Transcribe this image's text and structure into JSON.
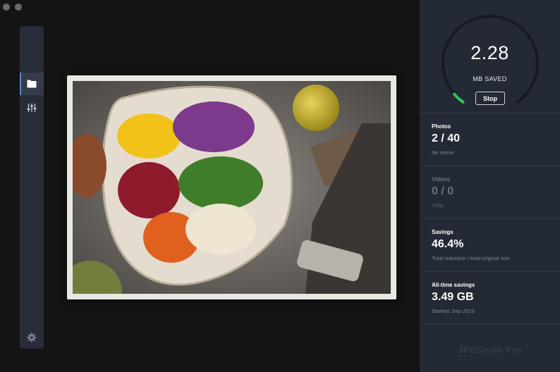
{
  "gauge": {
    "value": "2.28",
    "label": "MB SAVED",
    "stop_label": "Stop",
    "progress": 0.05,
    "progress_color": "#2fc95b"
  },
  "stats": [
    {
      "title": "Photos",
      "value": "2 / 40",
      "sub": "No resize",
      "dim": false
    },
    {
      "title": "Videos",
      "value": "0 / 0",
      "sub": "720p",
      "dim": true
    },
    {
      "title": "Savings",
      "value": "46.4%",
      "sub": "Total reduction / total original size",
      "dim": false
    },
    {
      "title": "All-time savings",
      "value": "3.49 GB",
      "sub": "Started: Sep 2023",
      "dim": false
    }
  ],
  "brand": "JPEGmini Pro",
  "toolbar": {
    "items": [
      {
        "icon": "folder-icon",
        "active": true
      },
      {
        "icon": "sliders-icon",
        "active": false
      }
    ],
    "bottom_icon": "gear-icon"
  },
  "colors": {
    "accent": "#5b87c4",
    "sidebar_bg": "#232a35",
    "app_bg": "#141414"
  }
}
